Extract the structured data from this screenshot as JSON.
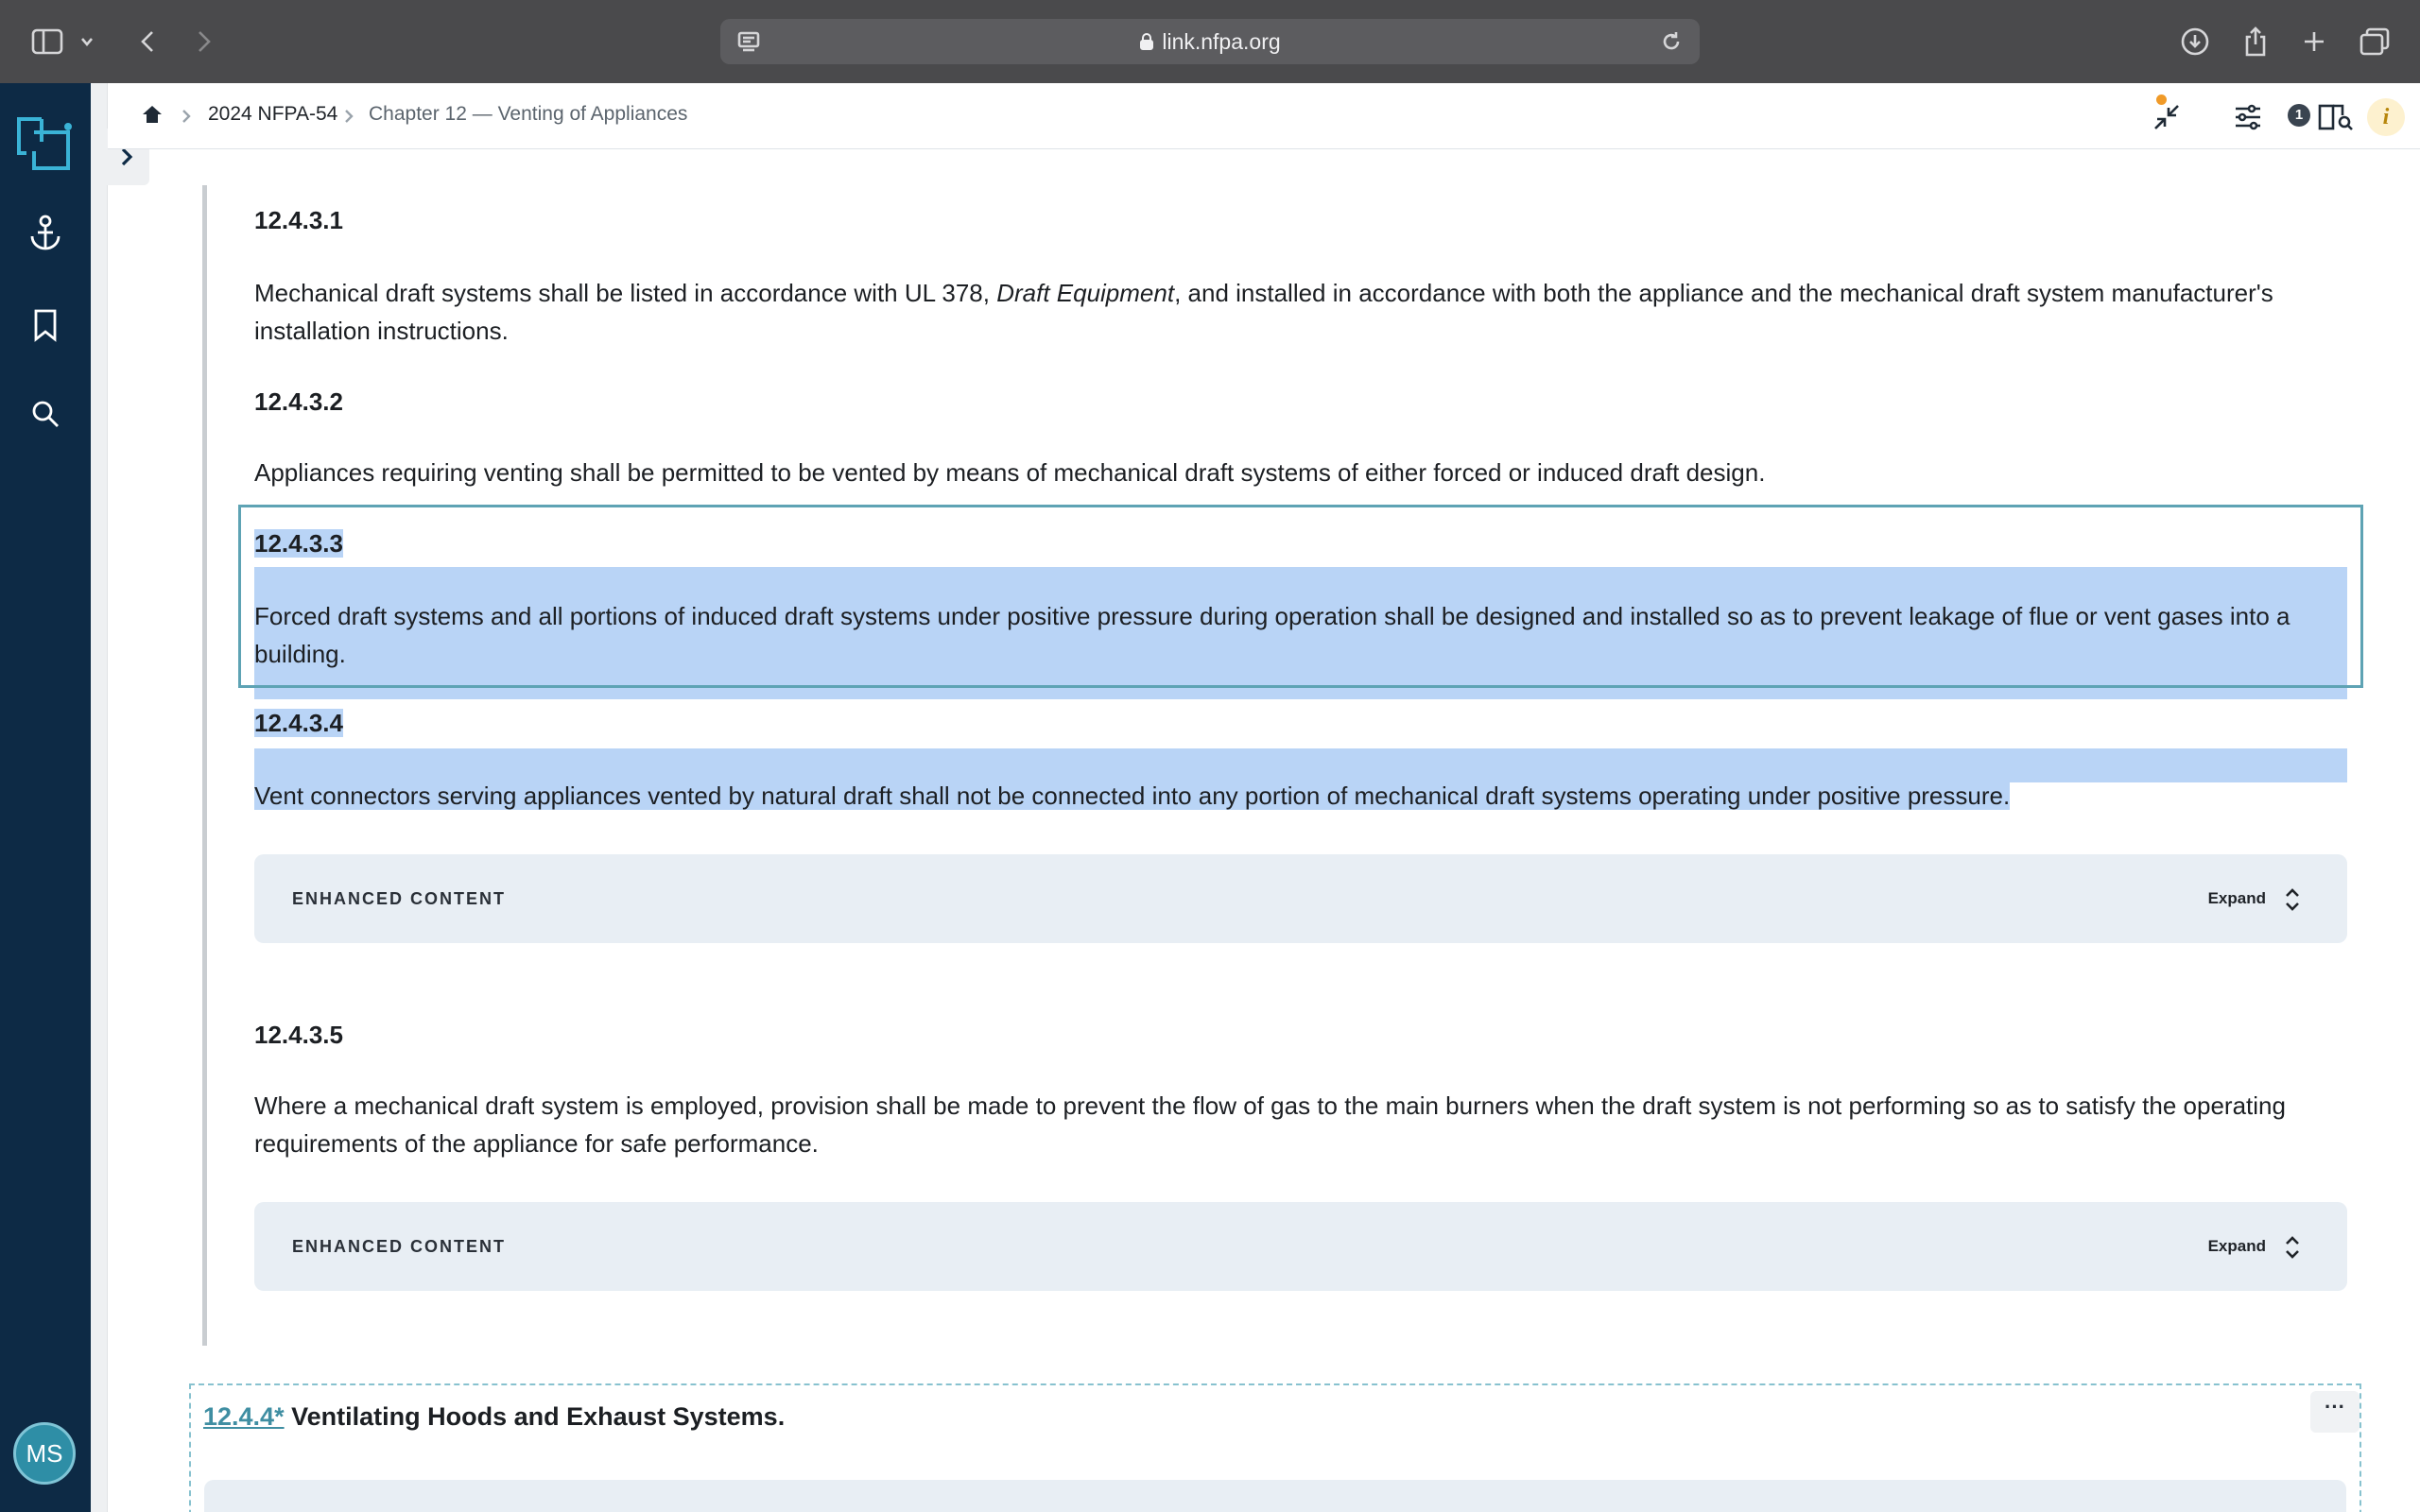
{
  "browser": {
    "url": "link.nfpa.org",
    "icons": [
      "sidebar-icon",
      "chevron-down-icon",
      "back-icon",
      "forward-icon",
      "reader-icon",
      "lock-icon",
      "reload-icon",
      "download-icon",
      "share-icon",
      "new-tab-icon",
      "tabs-overview-icon"
    ]
  },
  "rail": {
    "icons": [
      "app-logo-icon",
      "anchor-icon",
      "bookmark-icon",
      "search-icon"
    ],
    "avatar_initials": "MS"
  },
  "breadcrumb": {
    "items": [
      "2024 NFPA-54",
      "Chapter 12 — Venting of Appliances"
    ]
  },
  "toolbar": {
    "badge_count": "1",
    "info_label": "i",
    "icons": [
      "collapse-icon",
      "filter-icon",
      "compare-icon",
      "info-icon"
    ]
  },
  "sections": [
    {
      "number": "12.4.3.1",
      "text_before": "Mechanical draft systems shall be listed in accordance with UL 378, ",
      "text_italic": "Draft Equipment",
      "text_after": ", and installed in accordance with both the appliance and the mechanical draft system manufacturer's installation instructions."
    },
    {
      "number": "12.4.3.2",
      "text": "Appliances requiring venting shall be permitted to be vented by means of mechanical draft systems of either forced or induced draft design."
    },
    {
      "number": "12.4.3.3",
      "text": "Forced draft systems and all portions of induced draft systems under positive pressure during operation shall be designed and installed so as to prevent leakage of flue or vent gases into a building."
    },
    {
      "number": "12.4.3.4",
      "text": "Vent connectors serving appliances vented by natural draft shall not be connected into any portion of mechanical draft systems operating under positive pressure."
    },
    {
      "number": "12.4.3.5",
      "text": "Where a mechanical draft system is employed, provision shall be made to prevent the flow of gas to the main burners when the draft system is not performing so as to satisfy the operating requirements of the appliance for safe performance."
    }
  ],
  "enhanced_content": {
    "label": "ENHANCED CONTENT",
    "expand_label": "Expand"
  },
  "next_section": {
    "number": "12.4.4*",
    "title": " Ventilating Hoods and Exhaust Systems.",
    "more_label": "···"
  },
  "colors": {
    "rail": "#0d2a45",
    "selection": "#b9d4f6",
    "selection_border": "#5ea3b4",
    "link": "#3f8ea2",
    "enhanced_bg": "#e8eef4"
  }
}
